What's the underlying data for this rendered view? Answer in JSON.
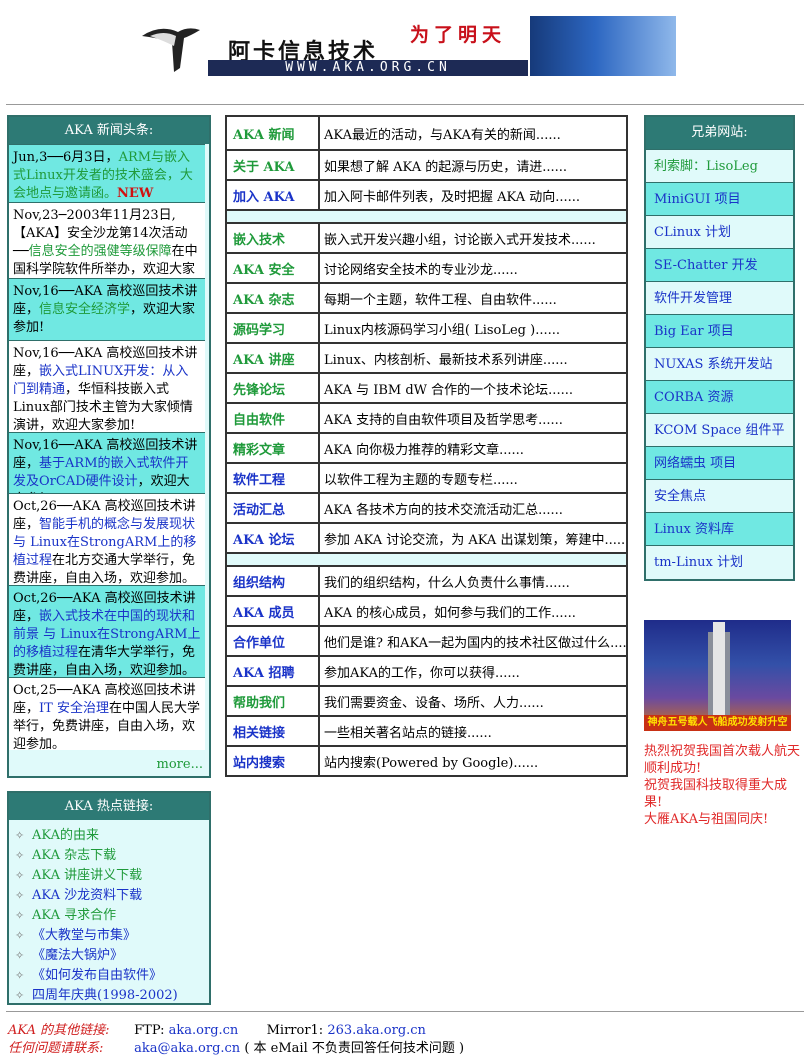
{
  "banner": {
    "title": "阿卡信息技术",
    "url": "WWW.AKA.ORG.CN",
    "slogan": "为了明天"
  },
  "news": {
    "heading": "AKA 新闻头条:",
    "items": [
      {
        "a": "Jun,3──6月3日，",
        "b": "ARM与嵌入式Linux开发者的技术盛会",
        "c": "，大会地点与邀请函。",
        "d": "NEW"
      },
      {
        "a": "Nov,23─2003年11月23日,【AKA】安全沙龙第14次活动──",
        "b": "信息安全的强健等级保障",
        "c": "在中国科学院软件所举办，欢迎大家参加。"
      },
      {
        "a": "Nov,16──AKA 高校巡回技术讲座，",
        "b": "信息安全经济学",
        "c": "，欢迎大家参加!"
      },
      {
        "a": "Nov,16──AKA 高校巡回技术讲座，",
        "b": "嵌入式LINUX开发：从入门到精通",
        "c": "，华恒科技嵌入式Linux部门技术主管为大家倾情演讲，欢迎大家参加!"
      },
      {
        "a": "Nov,16──AKA 高校巡回技术讲座，",
        "b": "基于ARM的嵌入式软件开发及OrCAD硬件设计",
        "c": "，欢迎大家参加!"
      },
      {
        "a": "Oct,26──AKA 高校巡回技术讲座，",
        "b": "智能手机的概念与发展现状 与 Linux在StrongARM上的移植过程",
        "c": "在北方交通大学举行，免费讲座，自由入场，欢迎参加。"
      },
      {
        "a": "Oct,26──AKA 高校巡回技术讲座，",
        "b": "嵌入式技术在中国的现状和前景 与 Linux在StrongARM上的移植过程",
        "c": "在清华大学举行，免费讲座，自由入场，欢迎参加。"
      },
      {
        "a": "Oct,25──AKA 高校巡回技术讲座，",
        "b": "IT 安全治理",
        "c": "在中国人民大学举行，免费讲座，自由入场，欢迎参加。"
      }
    ],
    "more": "more..."
  },
  "hot": {
    "heading": "AKA 热点链接:",
    "items": [
      "AKA的由来",
      "AKA 杂志下载",
      "AKA 讲座讲义下载",
      "AKA 沙龙资料下载",
      "AKA 寻求合作",
      "《大教堂与市集》",
      "《魔法大锅炉》",
      "《如何发布自由软件》",
      "四周年庆典(1998-2002)"
    ]
  },
  "main": {
    "group1": [
      {
        "k": "AKA 新闻",
        "v": "AKA最近的活动，与AKA有关的新闻......"
      },
      {
        "k": "关于 AKA",
        "v": "如果想了解 AKA 的起源与历史，请进......"
      },
      {
        "k": "加入 AKA",
        "v": "加入阿卡邮件列表，及时把握 AKA 动向......"
      }
    ],
    "group2": [
      {
        "k": "嵌入技术",
        "v": "嵌入式开发兴趣小组，讨论嵌入式开发技术......"
      },
      {
        "k": "AKA 安全",
        "v": "讨论网络安全技术的专业沙龙......"
      },
      {
        "k": "AKA 杂志",
        "v": "每期一个主题，软件工程、自由软件......"
      },
      {
        "k": "源码学习",
        "v": "Linux内核源码学习小组( LisoLeg )......"
      },
      {
        "k": "AKA 讲座",
        "v": "Linux、内核剖析、最新技术系列讲座......"
      },
      {
        "k": "先锋论坛",
        "v": "AKA 与 IBM dW 合作的一个技术论坛......"
      },
      {
        "k": "自由软件",
        "v": "AKA 支持的自由软件项目及哲学思考......"
      },
      {
        "k": "精彩文章",
        "v": "AKA 向你极力推荐的精彩文章......"
      },
      {
        "k": "软件工程",
        "v": "以软件工程为主题的专题专栏......"
      },
      {
        "k": "活动汇总",
        "v": "AKA 各技术方向的技术交流活动汇总......"
      },
      {
        "k": "AKA 论坛",
        "v": "参加 AKA 讨论交流，为 AKA 出谋划策，筹建中......"
      }
    ],
    "group3": [
      {
        "k": "组织结构",
        "v": "我们的组织结构，什么人负责什么事情......"
      },
      {
        "k": "AKA 成员",
        "v": "AKA 的核心成员，如何参与我们的工作......"
      },
      {
        "k": "合作单位",
        "v": "他们是谁? 和AKA一起为国内的技术社区做过什么......"
      },
      {
        "k": "AKA 招聘",
        "v": "参加AKA的工作，你可以获得......"
      },
      {
        "k": "帮助我们",
        "v": "我们需要资金、设备、场所、人力......"
      },
      {
        "k": "相关链接",
        "v": "一些相关著名站点的链接......"
      },
      {
        "k": "站内搜索",
        "v": "站内搜索(Powered by Google)......"
      }
    ]
  },
  "sites": {
    "heading": "兄弟网站:",
    "items": [
      "利索脚：LisoLeg",
      "MiniGUI 项目",
      "CLinux 计划",
      "SE-Chatter 开发",
      "软件开发管理",
      "Big Ear 项目",
      "NUXAS 系统开发站",
      "CORBA 资源",
      "KCOM Space 组件平台",
      "网络蠕虫 项目",
      "安全焦点",
      "Linux 资料库",
      "tm-Linux 计划"
    ]
  },
  "rocket_caption": "神舟五号载人飞船成功发射升空",
  "congrats": [
    "热烈祝贺我国首次载人航天顺利成功!",
    "祝贺我国科技取得重大成果!",
    "大雁AKA与祖国同庆!"
  ],
  "footer": {
    "links_label": "AKA 的其他链接:",
    "ftp_label": "FTP:",
    "ftp": "aka.org.cn",
    "mirror_label": "Mirror1:",
    "mirror": "263.aka.org.cn",
    "contact_label": "任何问题请联系:",
    "email": "aka@aka.org.cn",
    "note": "( 本 eMail 不负责回答任何技术问题 )"
  }
}
